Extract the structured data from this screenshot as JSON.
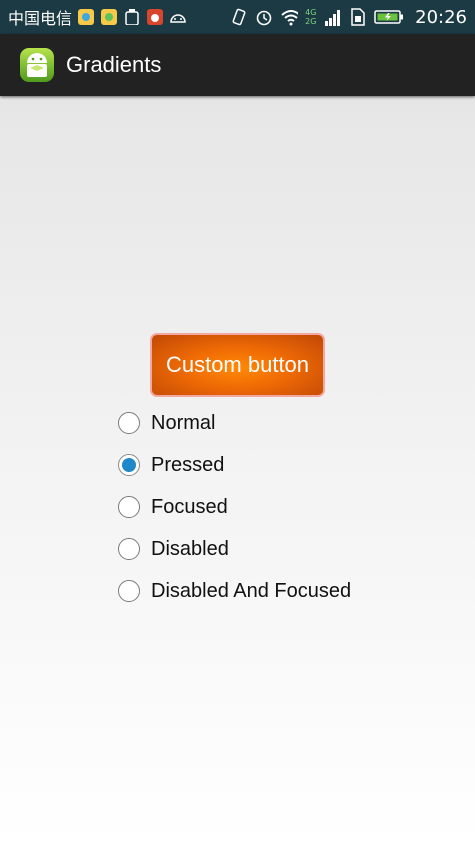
{
  "status_bar": {
    "carrier": "中国电信",
    "network": "4G 2G",
    "time": "20:26"
  },
  "action_bar": {
    "title": "Gradients"
  },
  "main": {
    "button_label": "Custom button",
    "radios": [
      {
        "label": "Normal",
        "checked": false
      },
      {
        "label": "Pressed",
        "checked": true
      },
      {
        "label": "Focused",
        "checked": false
      },
      {
        "label": "Disabled",
        "checked": false
      },
      {
        "label": "Disabled And Focused",
        "checked": false
      }
    ]
  },
  "colors": {
    "status_bar": "#1c3a44",
    "action_bar": "#222222",
    "button_orange": "#ee6a05",
    "radio_accent": "#1e88c8"
  }
}
